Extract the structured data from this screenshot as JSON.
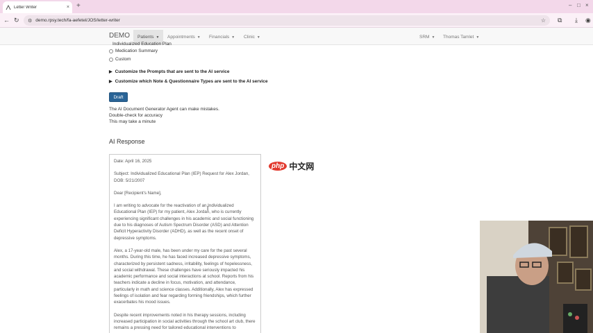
{
  "browser": {
    "tab_title": "Letter Writer",
    "tab_close": "×",
    "new_tab": "+",
    "window_controls": [
      "–",
      "□",
      "×"
    ],
    "url": "demo.rpsy.tech/fa-aefetel/JOS/letter-writer"
  },
  "navbar": {
    "brand": "DEMO",
    "items": [
      {
        "label": "Patients",
        "active": true
      },
      {
        "label": "Appointments",
        "active": false
      },
      {
        "label": "Financials",
        "active": false
      },
      {
        "label": "Clinic",
        "active": false
      }
    ],
    "right_items": [
      {
        "label": "SRM"
      },
      {
        "label": "Thomas Tamlet"
      }
    ]
  },
  "options": {
    "clipped_label": "Individualized Education Plan",
    "radios": [
      {
        "label": "Medication Summary"
      },
      {
        "label": "Custom"
      }
    ]
  },
  "collapsibles": [
    {
      "label": "Customize the Prompts that are sent to the AI service"
    },
    {
      "label": "Customize which Note & Questionnaire Types are sent to the AI service"
    }
  ],
  "draft_button": "Draft",
  "notes": [
    "The AI Document Generator Agent can make mistakes.",
    "Double-check for accuracy",
    "This may take a minute"
  ],
  "ai_response": {
    "title": "AI Response",
    "paragraphs": [
      "Date: April 16, 2025",
      "Subject: Individualized Educational Plan (IEP) Request for Alex Jordan, DOB: 5/21/2007",
      "Dear [Recipient's Name],",
      "I am writing to advocate for the reactivation of an Individualized Educational Plan (IEP) for my patient, Alex Jordan, who is currently experiencing significant challenges in his academic and social functioning due to his diagnoses of Autism Spectrum Disorder (ASD) and Attention Deficit Hyperactivity Disorder (ADHD), as well as the recent onset of depressive symptoms.",
      "Alex, a 17-year-old male, has been under my care for the past several months. During this time, he has faced increased depressive symptoms, characterized by persistent sadness, irritability, feelings of hopelessness, and social withdrawal. These challenges have seriously impacted his academic performance and social interactions at school. Reports from his teachers indicate a decline in focus, motivation, and attendance, particularly in math and science classes. Additionally, Alex has expressed feelings of isolation and fear regarding forming friendships, which further exacerbates his mood issues.",
      "Despite recent improvements noted in his therapy sessions, including increased participation in social activities through the school art club, there remains a pressing need for tailored educational interventions to"
    ]
  },
  "watermark": {
    "php": "php",
    "cn": "中文网"
  }
}
